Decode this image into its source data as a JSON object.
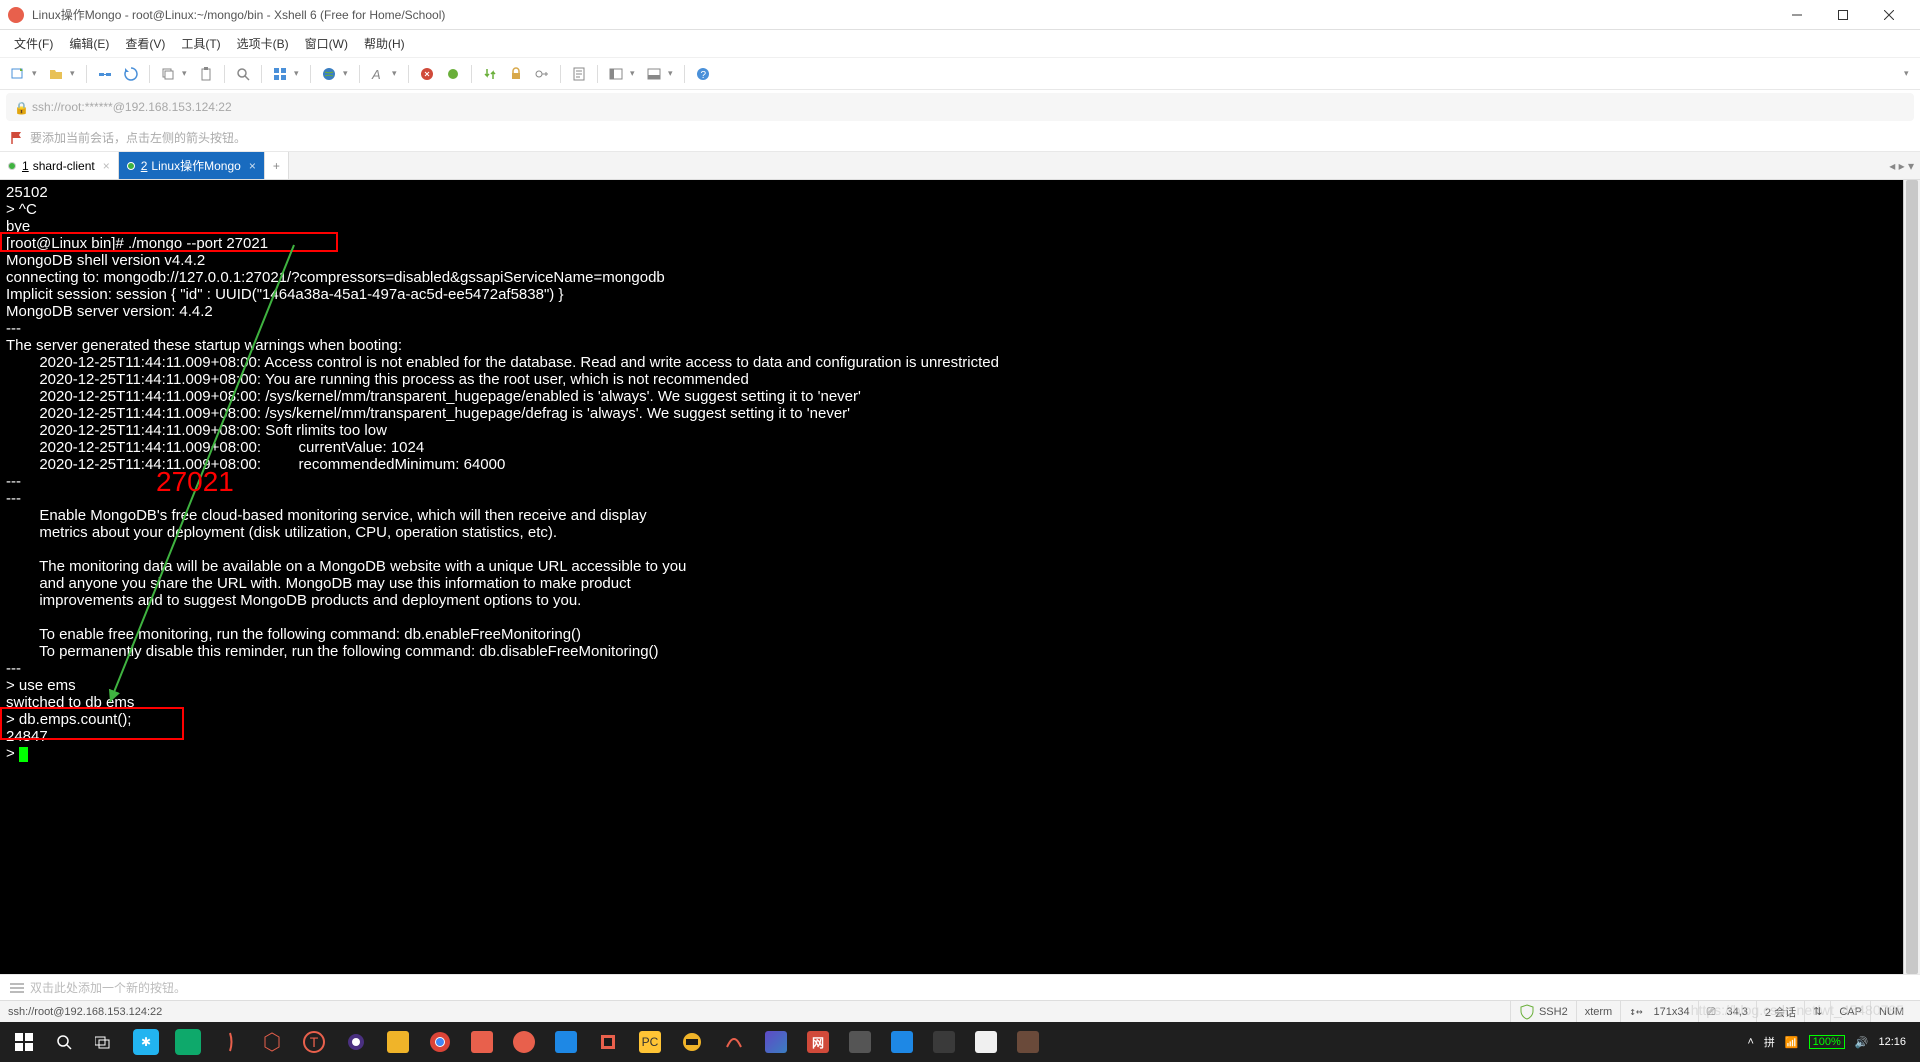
{
  "window": {
    "title": "Linux操作Mongo - root@Linux:~/mongo/bin - Xshell 6 (Free for Home/School)"
  },
  "menu": {
    "file": "文件(F)",
    "edit": "编辑(E)",
    "view": "查看(V)",
    "tools": "工具(T)",
    "tab": "选项卡(B)",
    "window": "窗口(W)",
    "help": "帮助(H)"
  },
  "address": "ssh://root:******@192.168.153.124:22",
  "hint": "要添加当前会话，点击左侧的箭头按钮。",
  "tabs": [
    {
      "num": "1",
      "label": "shard-client",
      "active": false
    },
    {
      "num": "2",
      "label": "Linux操作Mongo",
      "active": true
    }
  ],
  "terminal": {
    "lines": [
      "25102",
      "> ^C",
      "bye",
      "[root@Linux bin]# ./mongo --port 27021",
      "MongoDB shell version v4.4.2",
      "connecting to: mongodb://127.0.0.1:27021/?compressors=disabled&gssapiServiceName=mongodb",
      "Implicit session: session { \"id\" : UUID(\"1464a38a-45a1-497a-ac5d-ee5472af5838\") }",
      "MongoDB server version: 4.4.2",
      "---",
      "The server generated these startup warnings when booting:",
      "        2020-12-25T11:44:11.009+08:00: Access control is not enabled for the database. Read and write access to data and configuration is unrestricted",
      "        2020-12-25T11:44:11.009+08:00: You are running this process as the root user, which is not recommended",
      "        2020-12-25T11:44:11.009+08:00: /sys/kernel/mm/transparent_hugepage/enabled is 'always'. We suggest setting it to 'never'",
      "        2020-12-25T11:44:11.009+08:00: /sys/kernel/mm/transparent_hugepage/defrag is 'always'. We suggest setting it to 'never'",
      "        2020-12-25T11:44:11.009+08:00: Soft rlimits too low",
      "        2020-12-25T11:44:11.009+08:00:         currentValue: 1024",
      "        2020-12-25T11:44:11.009+08:00:         recommendedMinimum: 64000",
      "---",
      "---",
      "        Enable MongoDB's free cloud-based monitoring service, which will then receive and display",
      "        metrics about your deployment (disk utilization, CPU, operation statistics, etc).",
      "",
      "        The monitoring data will be available on a MongoDB website with a unique URL accessible to you",
      "        and anyone you share the URL with. MongoDB may use this information to make product",
      "        improvements and to suggest MongoDB products and deployment options to you.",
      "",
      "        To enable free monitoring, run the following command: db.enableFreeMonitoring()",
      "        To permanently disable this reminder, run the following command: db.disableFreeMonitoring()",
      "---",
      "> use ems",
      "switched to db ems",
      "> db.emps.count();",
      "24847",
      "> "
    ],
    "annotation_label": "27021"
  },
  "bottom_hint": "双击此处添加一个新的按钮。",
  "status": {
    "conn": "ssh://root@192.168.153.124:22",
    "proto": "SSH2",
    "term": "xterm",
    "size": "171x34",
    "pos": "34,3",
    "sess": "2 会话",
    "cap": "CAP",
    "num": "NUM"
  },
  "tray": {
    "battery": "100%",
    "time": "12:16",
    "watermark": "https://blog.csdn.net/wt_45480785"
  }
}
